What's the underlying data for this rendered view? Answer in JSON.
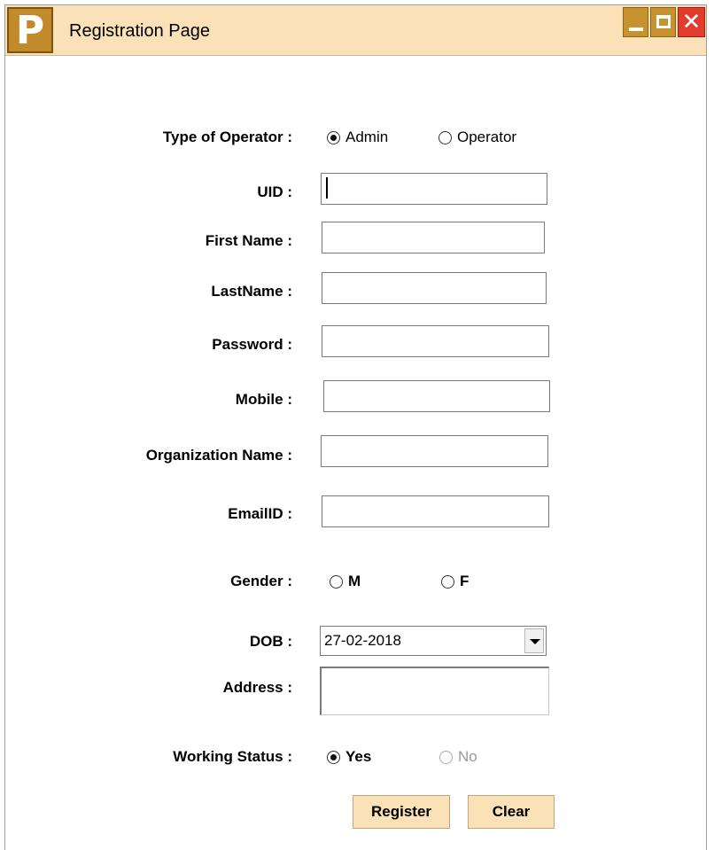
{
  "window": {
    "title": "Registration Page",
    "app_icon_letter": "P",
    "controls": {
      "minimize": "minimize-icon",
      "maximize": "maximize-icon",
      "close": "close-icon"
    },
    "colors": {
      "titlebar": "#fbe1b7",
      "icon": "#c28a2b",
      "close": "#e33b2c"
    }
  },
  "form": {
    "operator_type": {
      "label": "Type of Operator :",
      "options": [
        {
          "label": "Admin",
          "checked": true
        },
        {
          "label": "Operator",
          "checked": false
        }
      ]
    },
    "uid": {
      "label": "UID :",
      "value": ""
    },
    "first_name": {
      "label": "First Name :",
      "value": ""
    },
    "last_name": {
      "label": "LastName :",
      "value": ""
    },
    "password": {
      "label": "Password :",
      "value": ""
    },
    "mobile": {
      "label": "Mobile :",
      "value": ""
    },
    "organization_name": {
      "label": "Organization Name :",
      "value": ""
    },
    "email": {
      "label": "EmailID :",
      "value": ""
    },
    "gender": {
      "label": "Gender :",
      "options": [
        {
          "label": "M",
          "checked": false
        },
        {
          "label": "F",
          "checked": false
        }
      ]
    },
    "dob": {
      "label": "DOB :",
      "value": "27-02-2018"
    },
    "address": {
      "label": "Address :",
      "value": ""
    },
    "working_status": {
      "label": "Working Status :",
      "options": [
        {
          "label": "Yes",
          "checked": true
        },
        {
          "label": "No",
          "checked": false,
          "disabled": true
        }
      ]
    },
    "buttons": {
      "register": "Register",
      "clear": "Clear"
    }
  }
}
